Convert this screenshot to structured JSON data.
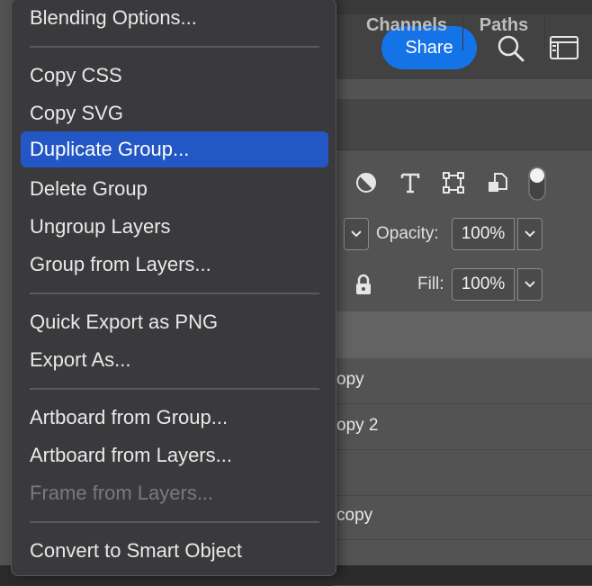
{
  "header": {
    "share_label": "Share"
  },
  "tabs": {
    "channels": "Channels",
    "paths": "Paths"
  },
  "layer_options": {
    "opacity_label": "Opacity:",
    "opacity_value": "100%",
    "fill_label": "Fill:",
    "fill_value": "100%"
  },
  "layers": [
    {
      "name": "opy"
    },
    {
      "name": "opy 2"
    },
    {
      "name": ""
    },
    {
      "name": "copy"
    },
    {
      "name": ""
    }
  ],
  "menu": {
    "blending_options": "Blending Options...",
    "copy_css": "Copy CSS",
    "copy_svg": "Copy SVG",
    "duplicate_group": "Duplicate Group...",
    "delete_group": "Delete Group",
    "ungroup_layers": "Ungroup Layers",
    "group_from_layers": "Group from Layers...",
    "quick_export_png": "Quick Export as PNG",
    "export_as": "Export As...",
    "artboard_from_group": "Artboard from Group...",
    "artboard_from_layers": "Artboard from Layers...",
    "frame_from_layers": "Frame from Layers...",
    "convert_smart_object": "Convert to Smart Object"
  },
  "colors": {
    "accent": "#1473e6",
    "highlight": "#2457c6",
    "menu_bg": "#3a3a3c",
    "panel_bg": "#535353"
  },
  "icons": [
    "search-icon",
    "workspace-icon",
    "adjustment-filter-icon",
    "type-filter-icon",
    "shape-filter-icon",
    "smart-object-filter-icon",
    "filter-toggle-icon",
    "lock-icon",
    "chevron-down-icon"
  ]
}
